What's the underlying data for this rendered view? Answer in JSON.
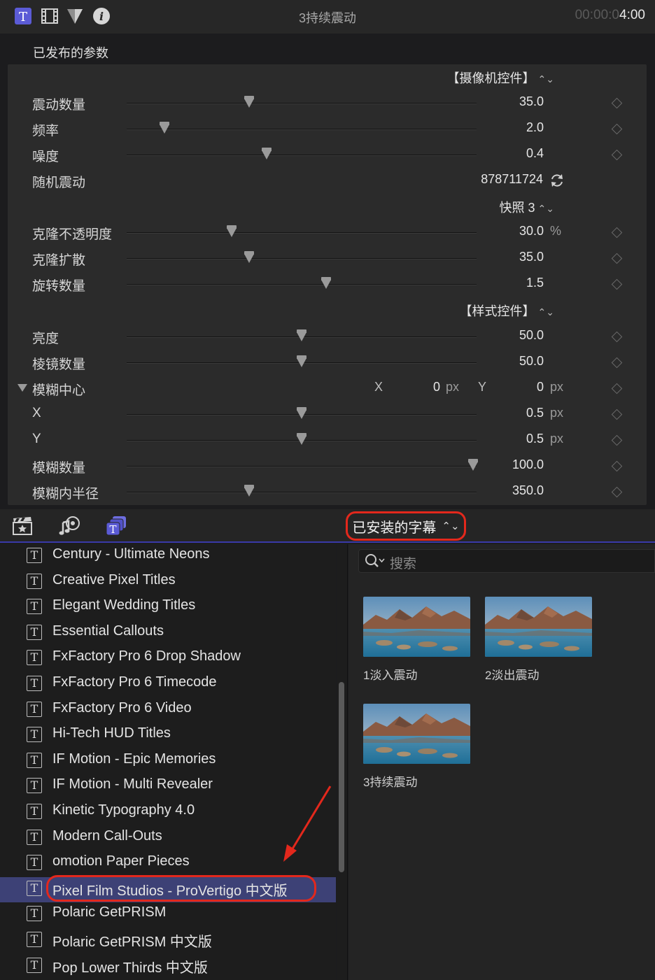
{
  "inspector": {
    "clip_title": "3持续震动",
    "timecode_dim": "00:00:0",
    "timecode_bright": "4:00",
    "tab_icons": [
      "title-inspector-icon",
      "video-inspector-icon",
      "color-inspector-icon",
      "info-inspector-icon"
    ],
    "section_title": "已发布的参数",
    "params": [
      {
        "type": "popup",
        "label": "【摄像机控件】"
      },
      {
        "type": "slider",
        "label": "震动数量",
        "value": "35.0",
        "pos": 0.35
      },
      {
        "type": "slider",
        "label": "频率",
        "value": "2.0",
        "pos": 0.108
      },
      {
        "type": "slider",
        "label": "噪度",
        "value": "0.4",
        "pos": 0.4
      },
      {
        "type": "random",
        "label": "随机震动",
        "value": "878711724"
      },
      {
        "type": "popup",
        "label": "快照 3"
      },
      {
        "type": "slider",
        "label": "克隆不透明度",
        "value": "30.0",
        "unit": "%",
        "pos": 0.3
      },
      {
        "type": "slider",
        "label": "克隆扩散",
        "value": "35.0",
        "pos": 0.35
      },
      {
        "type": "slider",
        "label": "旋转数量",
        "value": "1.5",
        "pos": 0.57
      },
      {
        "type": "popup",
        "label": "【样式控件】"
      },
      {
        "type": "slider",
        "label": "亮度",
        "value": "50.0",
        "pos": 0.5
      },
      {
        "type": "slider",
        "label": "棱镜数量",
        "value": "50.0",
        "pos": 0.5
      },
      {
        "type": "point",
        "label": "模糊中心",
        "x_label": "X",
        "x_value": "0",
        "y_label": "Y",
        "y_value": "0",
        "unit": "px"
      },
      {
        "type": "slider",
        "label": "X",
        "value": "0.5",
        "unit": "px",
        "pos": 0.5
      },
      {
        "type": "slider",
        "label": "Y",
        "value": "0.5",
        "unit": "px",
        "pos": 0.5
      },
      {
        "type": "slider",
        "label": "模糊数量",
        "value": "100.0",
        "pos": 0.99
      },
      {
        "type": "slider",
        "label": "模糊内半径",
        "value": "350.0",
        "pos": 0.35
      }
    ]
  },
  "browser": {
    "tab_icons": [
      "clapper-star-icon",
      "music-photo-icon",
      "titles-generators-icon"
    ],
    "installed_label": "已安装的字幕",
    "search_placeholder": "搜索",
    "list": [
      "Century - Ultimate Neons",
      "Creative Pixel Titles",
      "Elegant Wedding Titles",
      "Essential Callouts",
      "FxFactory Pro 6 Drop Shadow",
      "FxFactory Pro 6 Timecode",
      "FxFactory Pro 6 Video",
      "Hi-Tech HUD Titles",
      "IF Motion - Epic Memories",
      "IF Motion - Multi Revealer",
      "Kinetic Typography 4.0",
      "Modern Call-Outs",
      "omotion Paper Pieces",
      "Pixel Film Studios - ProVertigo 中文版",
      "Polaric GetPRISM",
      "Polaric GetPRISM 中文版",
      "Pop Lower Thirds 中文版"
    ],
    "selected_index": 13,
    "tiles": [
      "1淡入震动",
      "2淡出震动",
      "3持续震动"
    ]
  },
  "colors": {
    "accent": "#5b5bd6",
    "selection": "#3d4176",
    "highlight_ring": "#e3281c"
  }
}
